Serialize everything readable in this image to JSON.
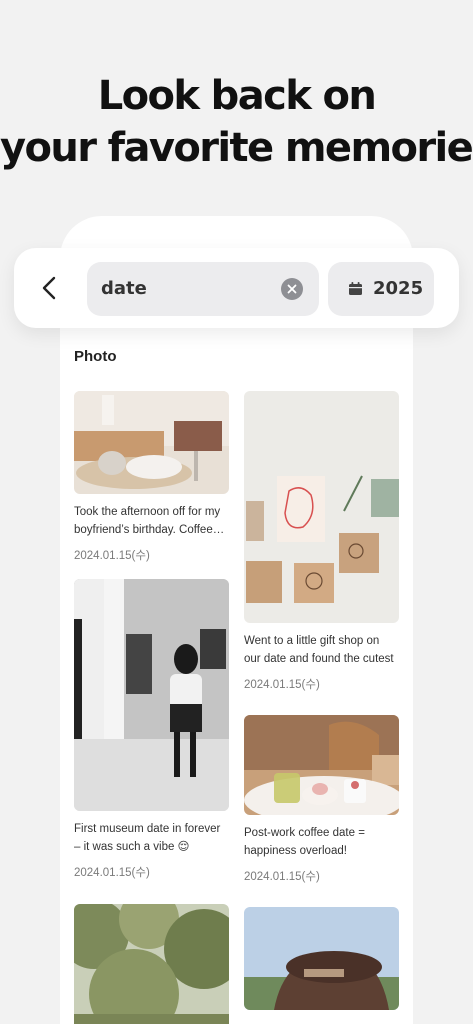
{
  "headline": {
    "line1": "Look back on",
    "line2": "your favorite memories"
  },
  "search": {
    "query": "date",
    "year": "2025"
  },
  "section": {
    "title": "Photo"
  },
  "posts": [
    {
      "caption": "Took the afternoon off for my boyfriend’s birthday. Coffee…",
      "date": "2024.01.15(수)"
    },
    {
      "caption": "Went to a little gift shop on our date and found the cutest ill…",
      "date": "2024.01.15(수)"
    },
    {
      "caption": "First museum date in forever – it was such a vibe 😌",
      "date": "2024.01.15(수)"
    },
    {
      "caption": "Post-work coffee date = happiness overload! Woohoo~",
      "date": "2024.01.15(수)"
    }
  ],
  "colors": {
    "background": "#f2f2f2",
    "card": "#ffffff",
    "field": "#ececee",
    "clear_icon": "#8e8f94"
  },
  "icons": [
    "back-chevron-icon",
    "clear-icon",
    "calendar-icon"
  ]
}
